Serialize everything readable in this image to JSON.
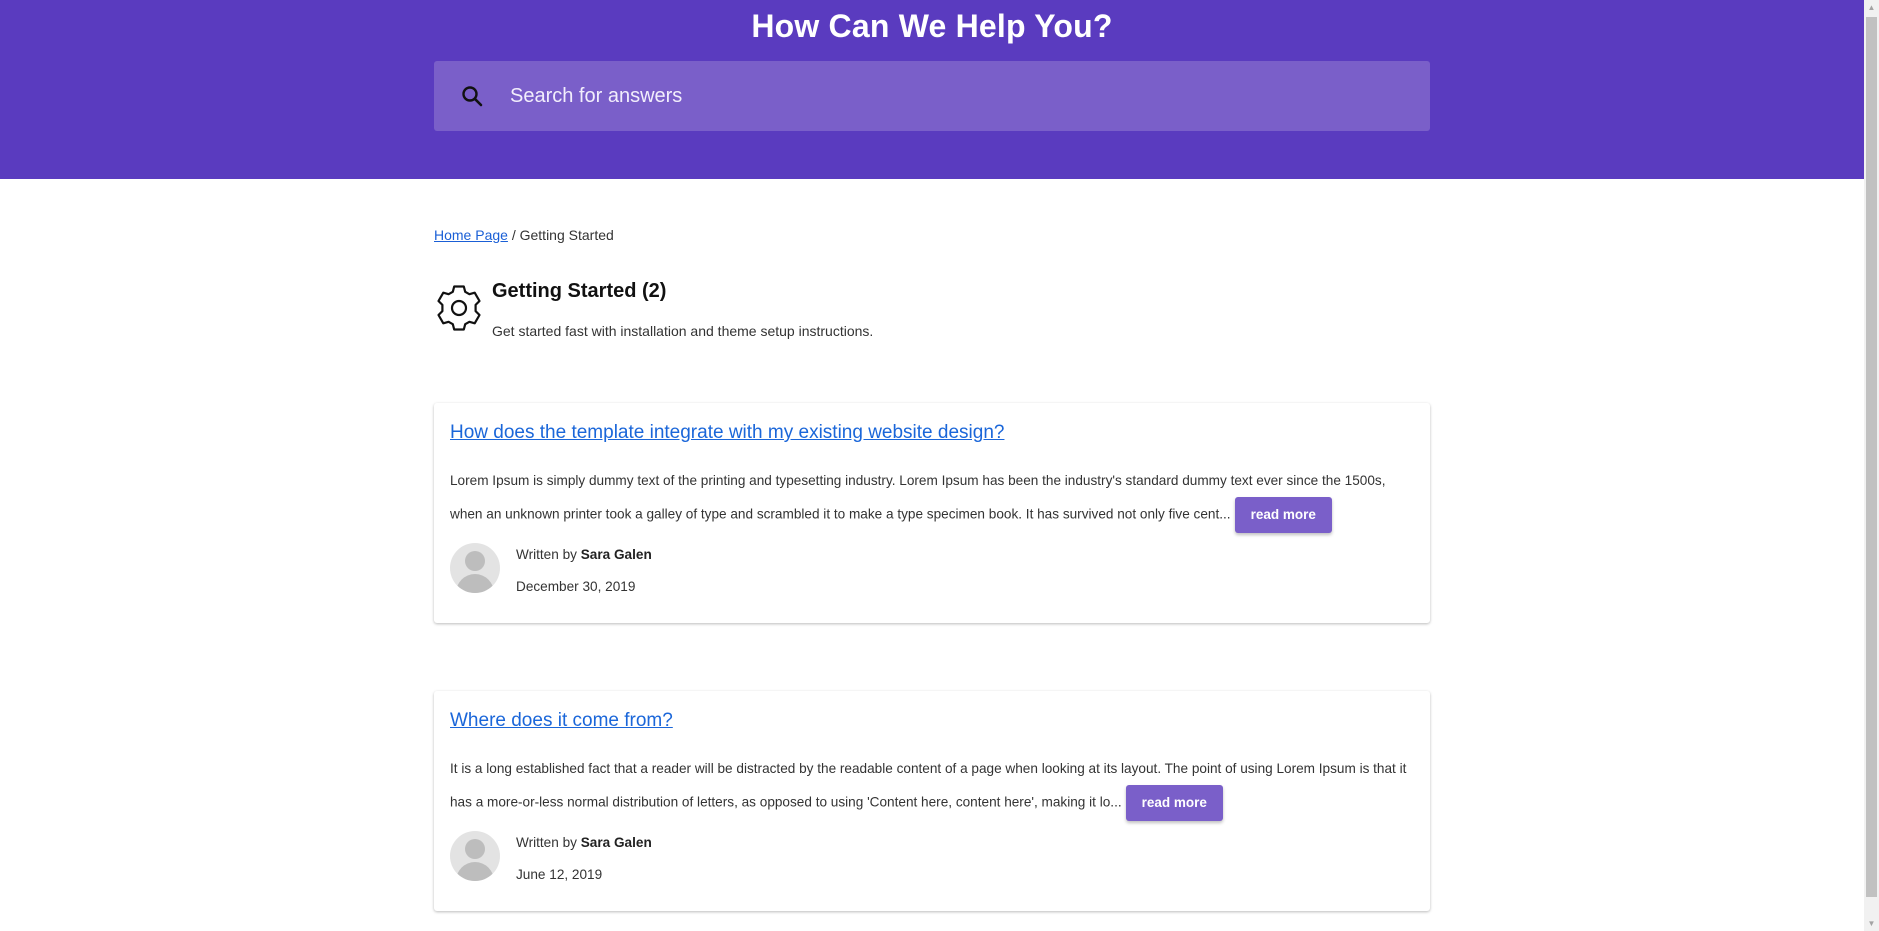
{
  "hero": {
    "title": "How Can We Help You?",
    "search_placeholder": "Search for answers",
    "background_color": "#5a3bbf"
  },
  "breadcrumb": {
    "home_label": "Home Page",
    "separator": " / ",
    "current": "Getting Started"
  },
  "category": {
    "icon": "gear-icon",
    "title": "Getting Started (2)",
    "description": "Get started fast with installation and theme setup instructions."
  },
  "articles": [
    {
      "title": "How does the template integrate with my existing website design?",
      "excerpt": "Lorem Ipsum is simply dummy text of the printing and typesetting industry. Lorem Ipsum has been the industry's standard dummy text ever since the 1500s, when an unknown printer took a galley of type and scrambled it to make a type specimen book. It has survived not only five cent...",
      "read_more_label": "read more",
      "written_by_label": "Written by",
      "author": "Sara Galen",
      "date": "December 30, 2019"
    },
    {
      "title": "Where does it come from?",
      "excerpt": "It is a long established fact that a reader will be distracted by the readable content of a page when looking at its layout. The point of using Lorem Ipsum is that it has a more-or-less normal distribution of letters, as opposed to using 'Content here, content here', making it lo...",
      "read_more_label": "read more",
      "written_by_label": "Written by",
      "author": "Sara Galen",
      "date": "June 12, 2019"
    }
  ],
  "colors": {
    "accent": "#7a5fc9",
    "link": "#1a66d9"
  }
}
